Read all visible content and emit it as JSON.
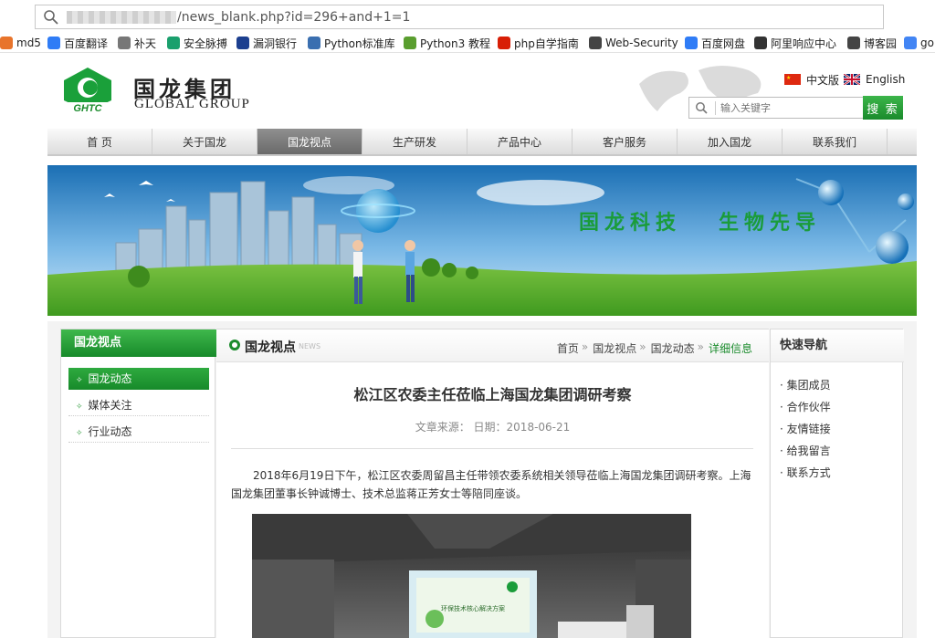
{
  "browser": {
    "url_text": "/news_blank.php?id=296+and+1=1",
    "bookmarks": [
      {
        "label": "md5",
        "icon": "md5-icon",
        "color": "#e8742b"
      },
      {
        "label": "百度翻译",
        "icon": "translate-icon",
        "color": "#2f7cf6"
      },
      {
        "label": "补天",
        "icon": "gear-icon",
        "color": "#777777"
      },
      {
        "label": "安全脉搏",
        "icon": "shield-icon",
        "color": "#1aa06d"
      },
      {
        "label": "漏洞银行",
        "icon": "bank-icon",
        "color": "#1c3f8f"
      },
      {
        "label": "Python标准库",
        "icon": "python-icon",
        "color": "#3a6fb0"
      },
      {
        "label": "Python3 教程",
        "icon": "python3-icon",
        "color": "#5a9e2f"
      },
      {
        "label": "php自学指南",
        "icon": "php-icon",
        "color": "#d81e06"
      },
      {
        "label": "Web-Security",
        "icon": "hat-icon",
        "color": "#444444"
      },
      {
        "label": "百度网盘",
        "icon": "cloud-icon",
        "color": "#2f7cf6"
      },
      {
        "label": "阿里响应中心",
        "icon": "globe-icon",
        "color": "#333333"
      },
      {
        "label": "博客园",
        "icon": "blog-icon",
        "color": "#444444"
      },
      {
        "label": "go",
        "icon": "google-icon",
        "color": "#4285f4"
      }
    ]
  },
  "site": {
    "logo_text": "GHTC",
    "name_cn": "国龙集团",
    "name_en": "GLOBAL GROUP",
    "lang_cn": "中文版",
    "lang_en": "English",
    "search_placeholder": "输入关键字",
    "search_button": "搜 索",
    "brand_green": "#1a8b2c"
  },
  "nav": {
    "items": [
      "首 页",
      "关于国龙",
      "国龙视点",
      "生产研发",
      "产品中心",
      "客户服务",
      "加入国龙",
      "联系我们"
    ],
    "active_index": 2
  },
  "banner": {
    "slogan_a": "国龙科技",
    "slogan_b": "生物先导"
  },
  "sidebar": {
    "title": "国龙视点",
    "items": [
      "国龙动态",
      "媒体关注",
      "行业动态"
    ],
    "active_index": 0
  },
  "main": {
    "section_title": "国龙视点",
    "section_title_en": "NEWS",
    "breadcrumb": [
      "首页",
      "国龙视点",
      "国龙动态",
      "详细信息"
    ],
    "breadcrumb_sep": "»",
    "article_title": "松江区农委主任莅临上海国龙集团调研考察",
    "article_meta": "文章来源： 日期：2018-06-21",
    "article_body": "2018年6月19日下午，松江区农委周留昌主任带领农委系统相关领导莅临上海国龙集团调研考察。上海国龙集团董事长钟诚博士、技术总监蒋正芳女士等陪同座谈。",
    "slide_title": "环保技术核心解决方案"
  },
  "quicknav": {
    "title": "快速导航",
    "items": [
      "· 集团成员",
      "· 合作伙伴",
      "· 友情链接",
      "· 给我留言",
      "· 联系方式"
    ]
  }
}
